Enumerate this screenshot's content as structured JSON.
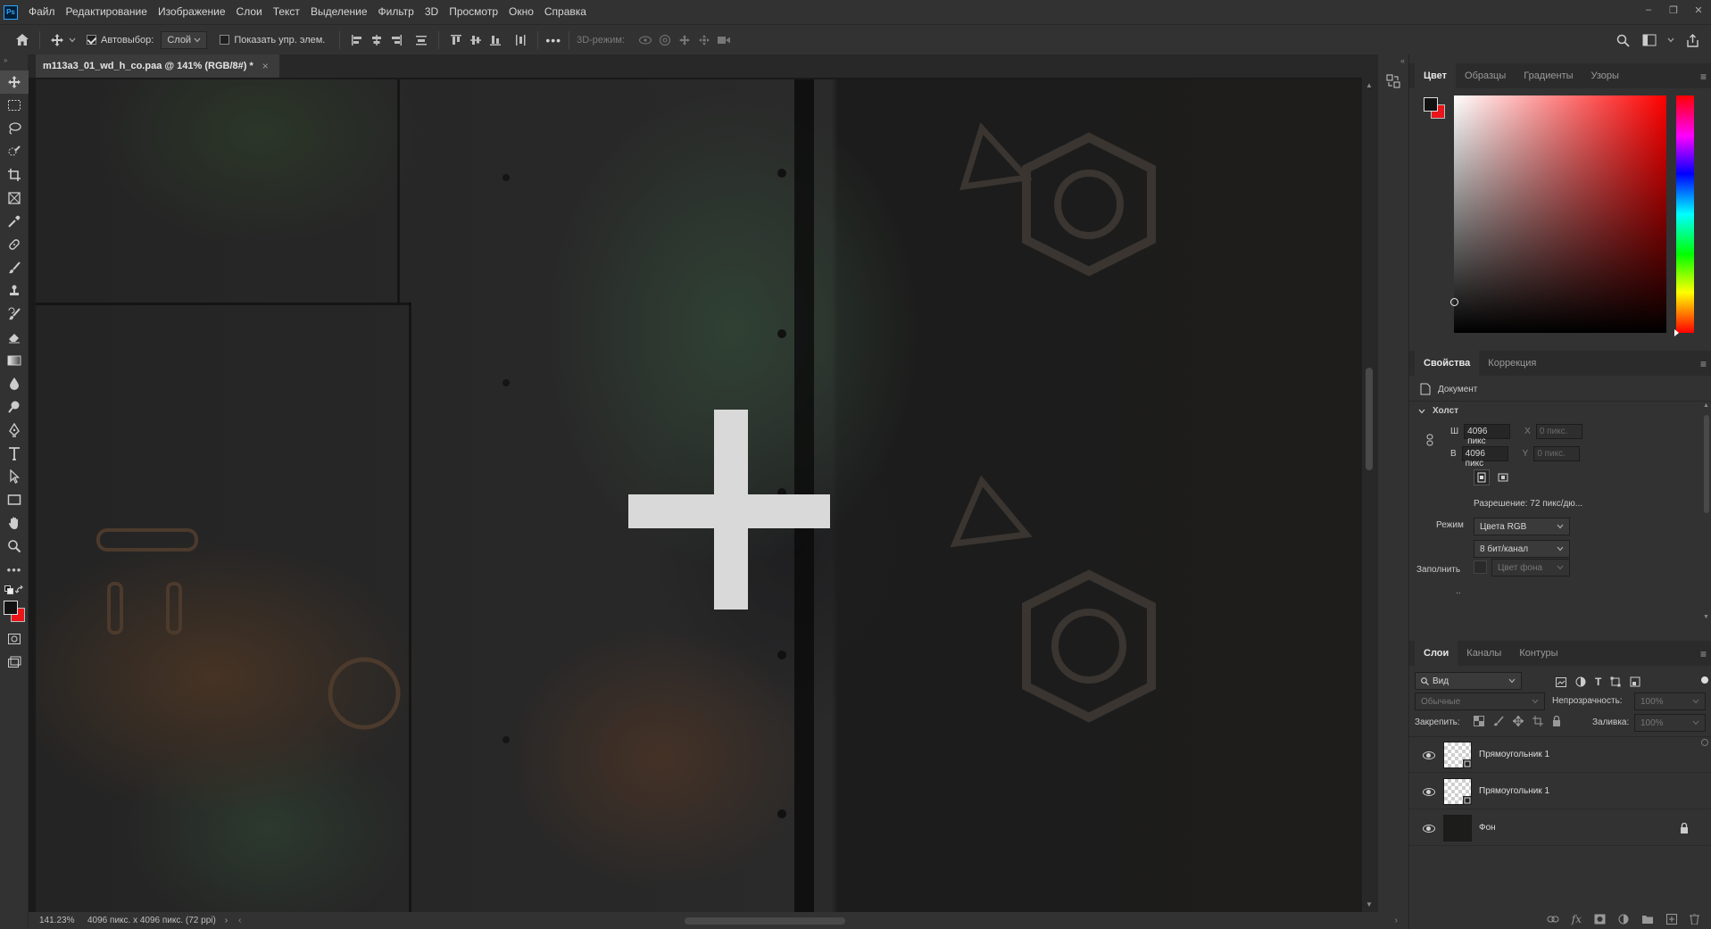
{
  "menubar": {
    "app_logo": "Ps",
    "items": [
      "Файл",
      "Редактирование",
      "Изображение",
      "Слои",
      "Текст",
      "Выделение",
      "Фильтр",
      "3D",
      "Просмотр",
      "Окно",
      "Справка"
    ],
    "window_controls": [
      "–",
      "❐",
      "✕"
    ]
  },
  "options": {
    "autoselect_label": "Автовыбор:",
    "autoselect_value": "Слой",
    "show_transform_label": "Показать упр. элем.",
    "mode_3d_label": "3D-режим:",
    "more": "•••"
  },
  "document": {
    "tab_title": "m113a3_01_wd_h_co.paa @ 141% (RGB/8#) *",
    "close": "×"
  },
  "status": {
    "zoom": "141.23%",
    "info": "4096 пикс. x 4096 пикс. (72 ppi)",
    "arrow": "›"
  },
  "color_panel": {
    "tabs": [
      "Цвет",
      "Образцы",
      "Градиенты",
      "Узоры"
    ],
    "foreground": "#111111",
    "background": "#e8151b"
  },
  "properties_panel": {
    "tabs": [
      "Свойства",
      "Коррекция"
    ],
    "doc_label": "Документ",
    "canvas_section": "Холст",
    "w_label": "Ш",
    "w_value": "4096 пикс",
    "h_label": "В",
    "h_value": "4096 пикс",
    "x_label": "X",
    "x_placeholder": "0 пикс.",
    "y_label": "Y",
    "y_placeholder": "0 пикс.",
    "resolution": "Разрешение: 72 пикс/дю...",
    "mode_label": "Режим",
    "mode_value": "Цвета RGB",
    "depth_value": "8 бит/канал",
    "fill_label": "Заполнить",
    "fill_value": "Цвет фона",
    "more": ".."
  },
  "layers_panel": {
    "tabs": [
      "Слои",
      "Каналы",
      "Контуры"
    ],
    "filter_value": "Вид",
    "blend_mode": "Обычные",
    "opacity_label": "Непрозрачность:",
    "opacity_value": "100%",
    "lock_label": "Закрепить:",
    "fill_label": "Заливка:",
    "fill_value": "100%",
    "layers": [
      {
        "name": "Прямоугольник 1",
        "type": "transparent"
      },
      {
        "name": "Прямоугольник 1",
        "type": "transparent"
      },
      {
        "name": "Фон",
        "type": "background",
        "locked": true
      }
    ],
    "bottom_icons": [
      "link-icon",
      "fx-icon",
      "mask-icon",
      "adjustment-icon",
      "folder-icon",
      "new-layer-icon",
      "trash-icon"
    ]
  }
}
